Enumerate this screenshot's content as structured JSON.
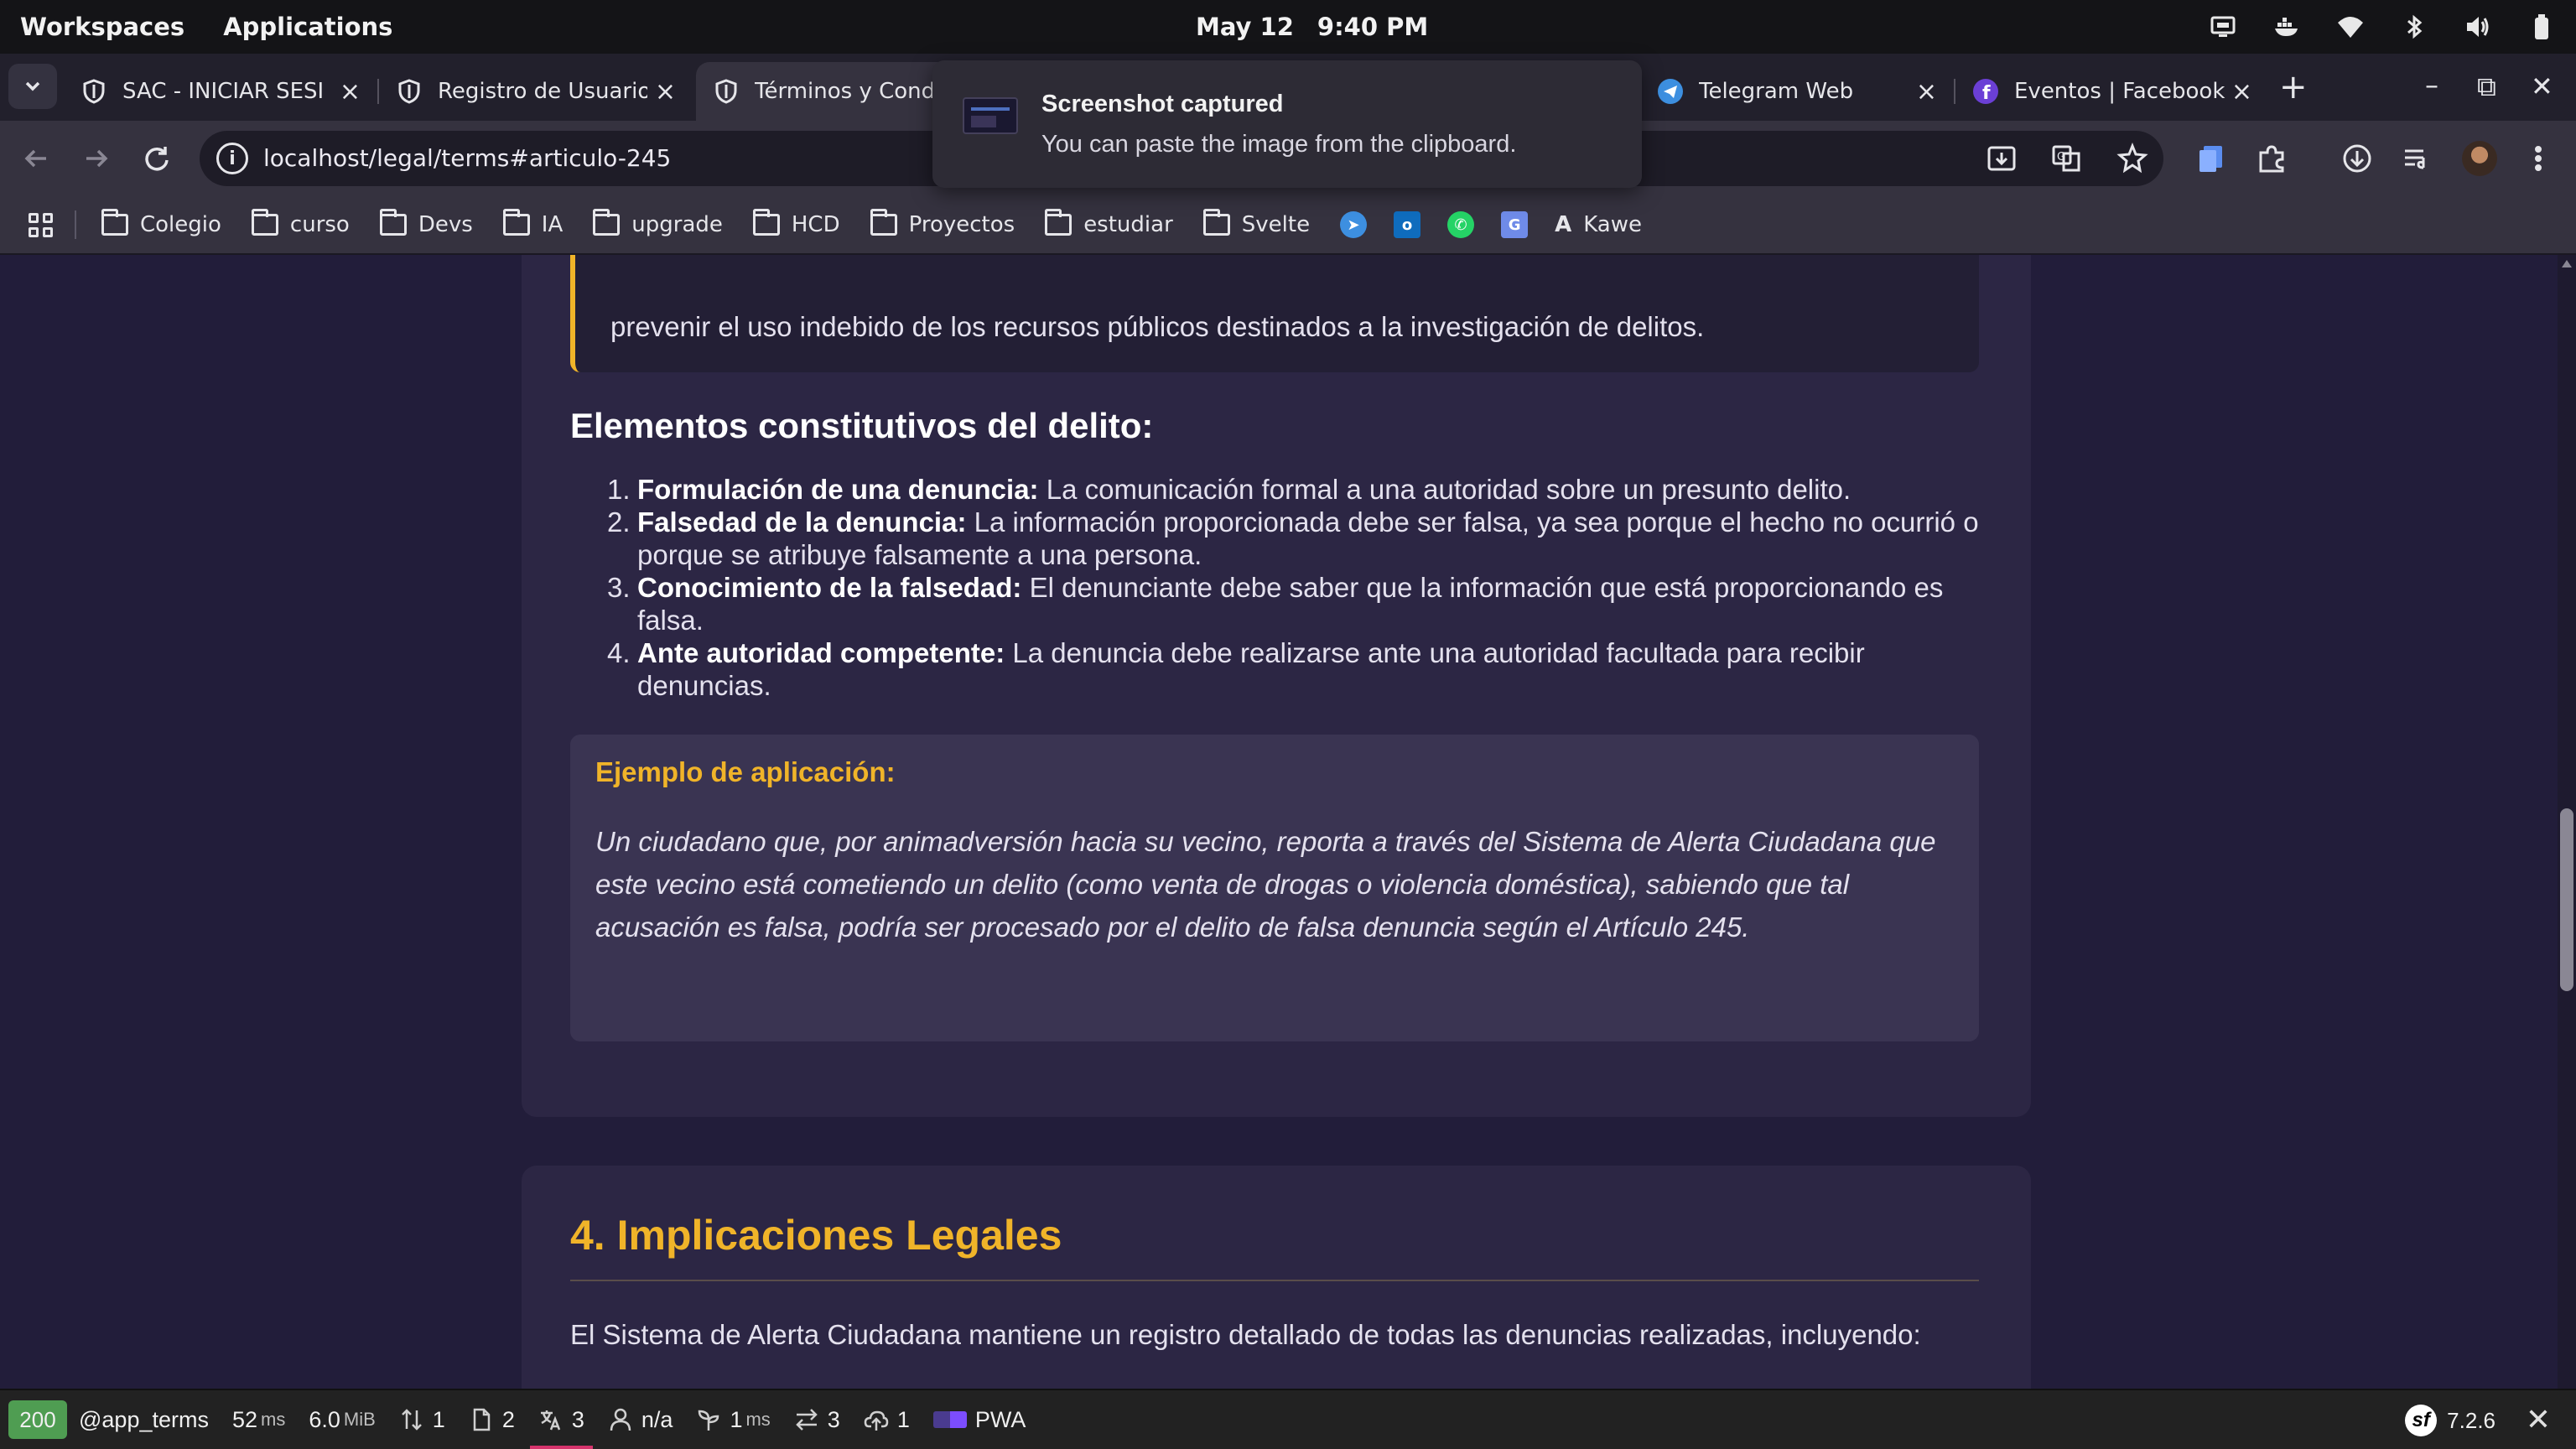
{
  "os": {
    "workspaces": "Workspaces",
    "applications": "Applications",
    "date": "May 12",
    "time": "9:40 PM"
  },
  "tabs": [
    {
      "label": "SAC - INICIAR SESIÓN",
      "active": false
    },
    {
      "label": "Registro de Usuario",
      "active": false
    },
    {
      "label": "Términos y Condiciones",
      "active": true
    },
    {
      "label": "Telegram Web",
      "active": false
    },
    {
      "label": "Eventos | Facebook",
      "active": false
    }
  ],
  "address": {
    "url": "localhost/legal/terms#articulo-245"
  },
  "bookmarks": [
    {
      "label": "Colegio"
    },
    {
      "label": "curso"
    },
    {
      "label": "Devs"
    },
    {
      "label": "IA"
    },
    {
      "label": "upgrade"
    },
    {
      "label": "HCD"
    },
    {
      "label": "Proyectos"
    },
    {
      "label": "estudiar"
    },
    {
      "label": "Svelte"
    }
  ],
  "bookmark_kawe": "Kawe",
  "notification": {
    "title": "Screenshot captured",
    "body": "You can paste the image from the clipboard."
  },
  "content": {
    "quote_tail": "prevenir el uso indebido de los recursos públicos destinados a la investigación de delitos.",
    "elements_heading": "Elementos constitutivos del delito:",
    "elements": [
      {
        "num": "1.",
        "term": "Formulación de una denuncia:",
        "text": " La comunicación formal a una autoridad sobre un presunto delito."
      },
      {
        "num": "2.",
        "term": "Falsedad de la denuncia:",
        "text": " La información proporcionada debe ser falsa, ya sea porque el hecho no ocurrió o porque se atribuye falsamente a una persona."
      },
      {
        "num": "3.",
        "term": "Conocimiento de la falsedad:",
        "text": " El denunciante debe saber que la información que está proporcionando es falsa."
      },
      {
        "num": "4.",
        "term": "Ante autoridad competente:",
        "text": " La denuncia debe realizarse ante una autoridad facultada para recibir denuncias."
      }
    ],
    "example_heading": "Ejemplo de aplicación:",
    "example_body": "Un ciudadano que, por animadversión hacia su vecino, reporta a través del Sistema de Alerta Ciudadana que este vecino está cometiendo un delito (como venta de drogas o violencia doméstica), sabiendo que tal acusación es falsa, podría ser procesado por el delito de falsa denuncia según el Artículo 245.",
    "section_heading": "4. Implicaciones Legales",
    "section_para": "El Sistema de Alerta Ciudadana mantiene un registro detallado de todas las denuncias realizadas, incluyendo:"
  },
  "symfony": {
    "status": "200",
    "route": "@app_terms",
    "time_value": "52",
    "time_unit": "ms",
    "memory_value": "6.0",
    "memory_unit": "MiB",
    "requests": "1",
    "forms": "2",
    "translations": "3",
    "user": "n/a",
    "cache_value": "1",
    "cache_unit": "ms",
    "events": "3",
    "uploads": "1",
    "pwa": "PWA",
    "version": "7.2.6"
  },
  "colors": {
    "accent": "#f0b429",
    "page_bg": "#221d3a",
    "card_bg": "#2c2644",
    "status_ok": "#4f9d52"
  }
}
